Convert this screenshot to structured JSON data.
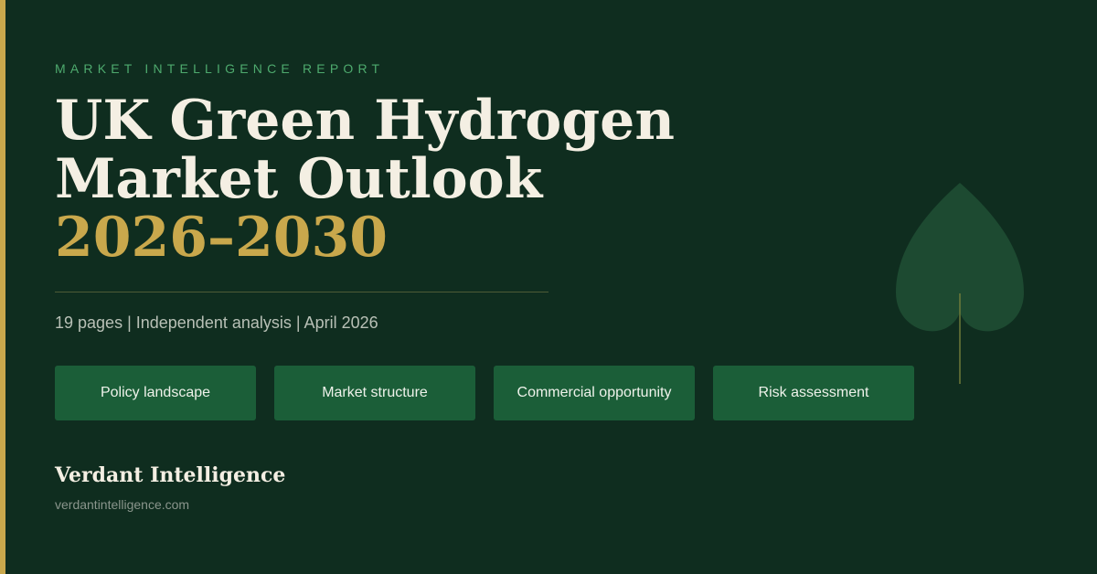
{
  "report": {
    "eyebrow": "MARKET INTELLIGENCE REPORT",
    "title_line_1": "UK Green Hydrogen",
    "title_line_2": "Market Outlook",
    "title_years": "2026–2030",
    "meta": "19 pages | Independent analysis | April 2026"
  },
  "topics": [
    {
      "label": "Policy landscape"
    },
    {
      "label": "Market structure"
    },
    {
      "label": "Commercial opportunity"
    },
    {
      "label": "Risk assessment"
    }
  ],
  "publisher": {
    "name": "Verdant Intelligence",
    "website": "verdantintelligence.com"
  },
  "decoration": {
    "icon": "leaf-icon"
  },
  "colors": {
    "background": "#0f2d1f",
    "accent_gold": "#c9a84c",
    "eyebrow_green": "#4eaa6e",
    "pill_green": "#1b5e38",
    "leaf_green": "#1d4a31"
  }
}
